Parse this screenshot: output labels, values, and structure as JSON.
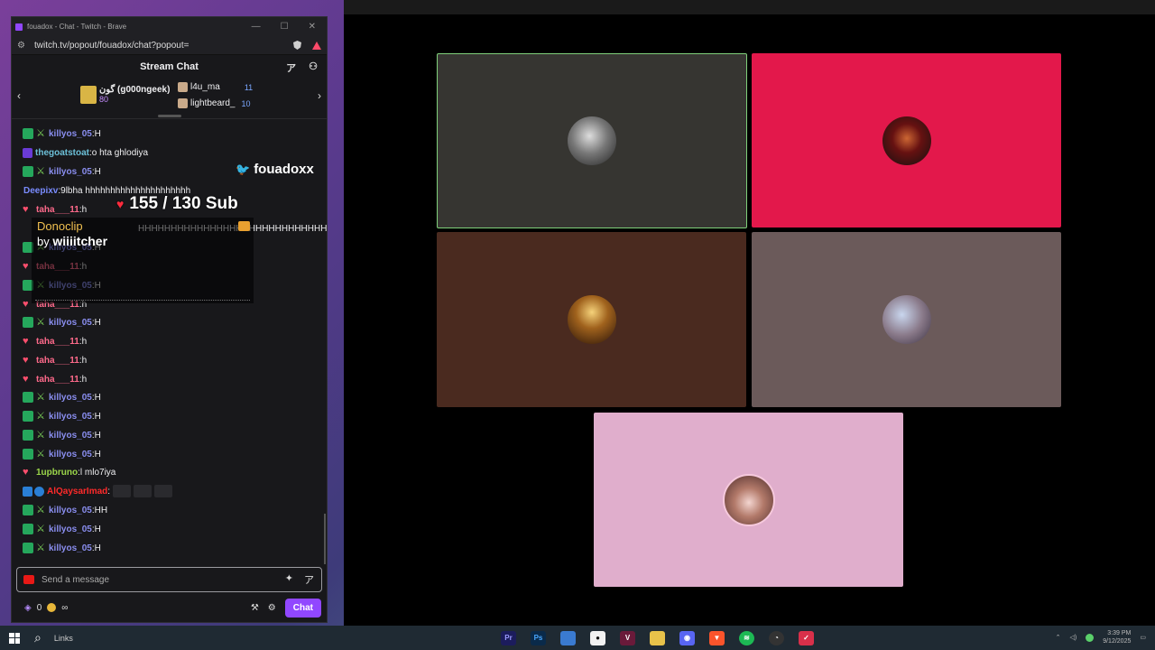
{
  "browser": {
    "window_title": "fouadox - Chat - Twitch - Brave",
    "url": "twitch.tv/popout/fouadox/chat?popout=",
    "controls": [
      "—",
      "☐",
      "✕"
    ]
  },
  "chat": {
    "header_title": "Stream Chat",
    "gift_leader": {
      "first_name": "ﮔﻮﻥ (g000ngeek)",
      "first_count": "80",
      "second_name": "l4u_ma",
      "second_count": "11",
      "third_name": "lightbeard_",
      "third_count": "10"
    },
    "messages": [
      {
        "user": "killyos_05",
        "text": "H",
        "style": "k"
      },
      {
        "user": "thegoatstoat",
        "text": "o hta ghlodiya",
        "style": "g"
      },
      {
        "user": "killyos_05",
        "text": "H",
        "style": "k"
      },
      {
        "user": "Deepixv",
        "text": "9lbha hhhhhhhhhhhhhhhhhhhhh",
        "style": "d"
      },
      {
        "user": "taha___11",
        "text": "h",
        "style": "t"
      },
      {
        "user": "",
        "text": "HHHHHHHHHHHHHHHHHHHHHHHHHHHHH",
        "style": "x"
      },
      {
        "user": "killyos_05",
        "text": "H",
        "style": "k"
      },
      {
        "user": "taha___11",
        "text": "h",
        "style": "t"
      },
      {
        "user": "killyos_05",
        "text": "H",
        "style": "k"
      },
      {
        "user": "taha___11",
        "text": "h",
        "style": "t"
      },
      {
        "user": "killyos_05",
        "text": "H",
        "style": "k"
      },
      {
        "user": "taha___11",
        "text": "h",
        "style": "t"
      },
      {
        "user": "taha___11",
        "text": "h",
        "style": "t"
      },
      {
        "user": "taha___11",
        "text": "h",
        "style": "t"
      },
      {
        "user": "killyos_05",
        "text": "H",
        "style": "k"
      },
      {
        "user": "killyos_05",
        "text": "H",
        "style": "k"
      },
      {
        "user": "killyos_05",
        "text": "H",
        "style": "k"
      },
      {
        "user": "killyos_05",
        "text": "H",
        "style": "k"
      },
      {
        "user": "1upbruno",
        "text": "l mlo7iya",
        "style": "1"
      },
      {
        "user": "AlQaysarImad",
        "text": "",
        "style": "a"
      },
      {
        "user": "killyos_05",
        "text": "HH",
        "style": "k"
      },
      {
        "user": "killyos_05",
        "text": "H",
        "style": "k"
      },
      {
        "user": "killyos_05",
        "text": "H",
        "style": "k"
      }
    ],
    "input_placeholder": "Send a message",
    "points_count": "0",
    "infinity": "∞",
    "chat_button": "Chat"
  },
  "overlay": {
    "twitter_handle": "fouadoxx",
    "sub_goal": "155 / 130 Sub",
    "clip_title": "Donoclip",
    "clip_by": "by",
    "clip_author": "wiiiitcher"
  },
  "taskbar": {
    "search_text": "Links",
    "time": "3:39 PM",
    "date": "9/12/2025"
  },
  "colors": {
    "twitch_purple": "#9147ff",
    "active_speaker_border": "#7fd07a",
    "tile_red": "#e3184b",
    "tile_pink": "#e0aecc"
  }
}
